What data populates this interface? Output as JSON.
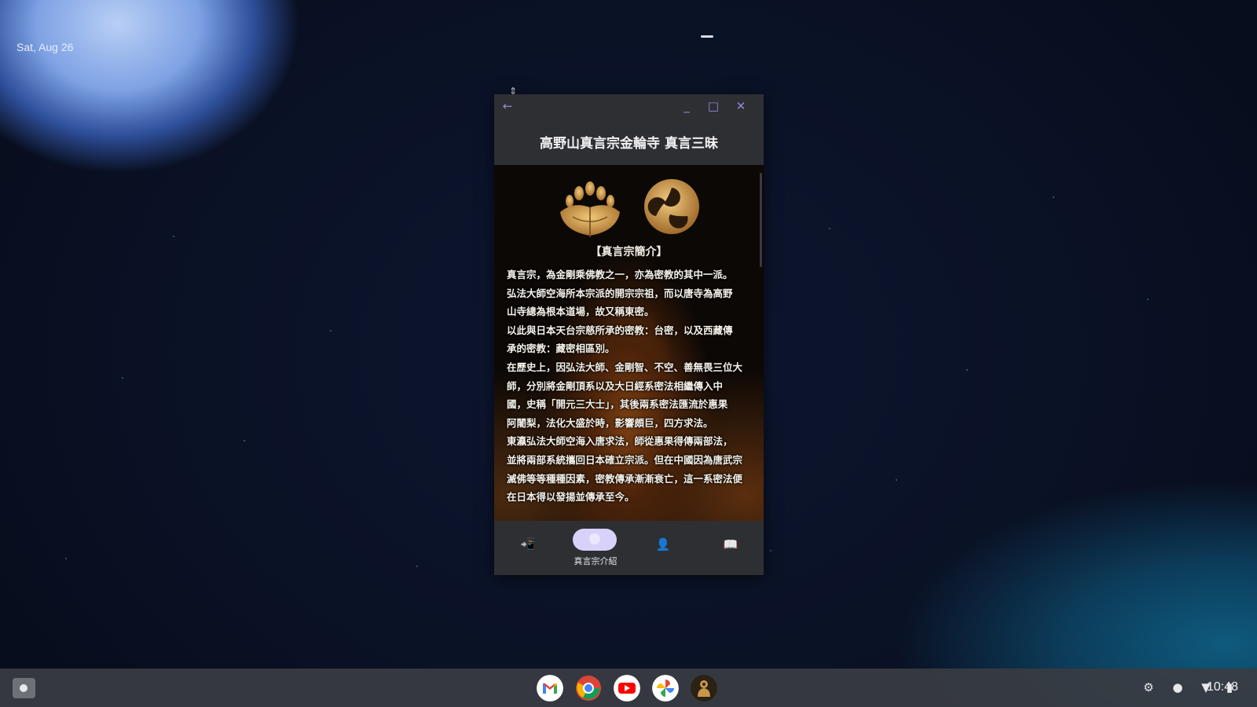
{
  "desktop": {
    "date": "Sat, Aug 26"
  },
  "window": {
    "drag_handle": "⇕",
    "back_icon": "←",
    "minimize_icon": "_",
    "maximize_icon": "□",
    "close_icon": "✕",
    "title": "高野山真言宗金輪寺 真言三昧"
  },
  "article": {
    "heading": "【真言宗簡介】",
    "lines": [
      "真言宗，為金剛乘佛教之一，亦為密教的其中一派。",
      "弘法大師空海所本宗派的開宗宗祖，而以唐寺為高野",
      "山寺總為根本道場，故又稱東密。",
      "以此與日本天台宗慈所承的密教：台密，以及西藏傳",
      "承的密教：藏密相區別。",
      "在歷史上，因弘法大師、金剛智、不空、善無畏三位大",
      "師，分別將金剛頂系以及大日經系密法相繼傳入中",
      "國，史稱「開元三大士」，其後兩系密法匯流於惠果",
      "阿闍梨，法化大盛於時，影響頗巨，四方求法。",
      "東瀛弘法大師空海入唐求法，師從惠果得傳兩部法，",
      "並將兩部系統攜回日本確立宗派。但在中國因為唐武宗",
      "滅佛等等種種因素，密教傳承漸漸衰亡，這一系密法便",
      "在日本得以發揚並傳承至今。"
    ]
  },
  "bottom_nav": {
    "items": [
      {
        "icon": "📲",
        "label": ""
      },
      {
        "icon": "●",
        "label": "真言宗介紹"
      },
      {
        "icon": "👤",
        "label": ""
      },
      {
        "icon": "📖",
        "label": ""
      }
    ]
  },
  "shelf": {
    "apps": [
      "gmail-icon",
      "chrome-icon",
      "youtube-icon",
      "photos-icon",
      "temple-app-icon"
    ],
    "status": {
      "settings_icon": "⚙",
      "info_icon": "●",
      "wifi_icon": "▼",
      "battery_icon": "▮",
      "time": "10:48"
    }
  },
  "colors": {
    "window_bg": "#2e2f33",
    "accent": "#8e8ad7",
    "nav_pill": "#d8d2fb",
    "gold": "#c9974a"
  }
}
